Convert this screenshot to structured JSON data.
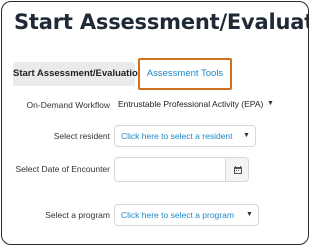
{
  "page": {
    "title": "Start Assessment/Evaluation"
  },
  "tabs": [
    {
      "label": "Start Assessment/Evaluation",
      "active": false
    },
    {
      "label": "Assessment Tools",
      "active": true,
      "highlight_color": "#d0711e"
    }
  ],
  "form": {
    "workflow": {
      "label": "On-Demand Workflow",
      "value": "Entrustable Professional Activity (EPA)"
    },
    "resident": {
      "label": "Select resident",
      "value": "Click here to select a resident"
    },
    "date": {
      "label": "Select Date of Encounter",
      "value": "",
      "icon": "calendar-icon"
    },
    "program": {
      "label": "Select a program",
      "value": "Click here to select a program"
    }
  },
  "colors": {
    "link_blue": "#1e88c7",
    "title": "#1f2a36",
    "highlight": "#d0711e"
  }
}
